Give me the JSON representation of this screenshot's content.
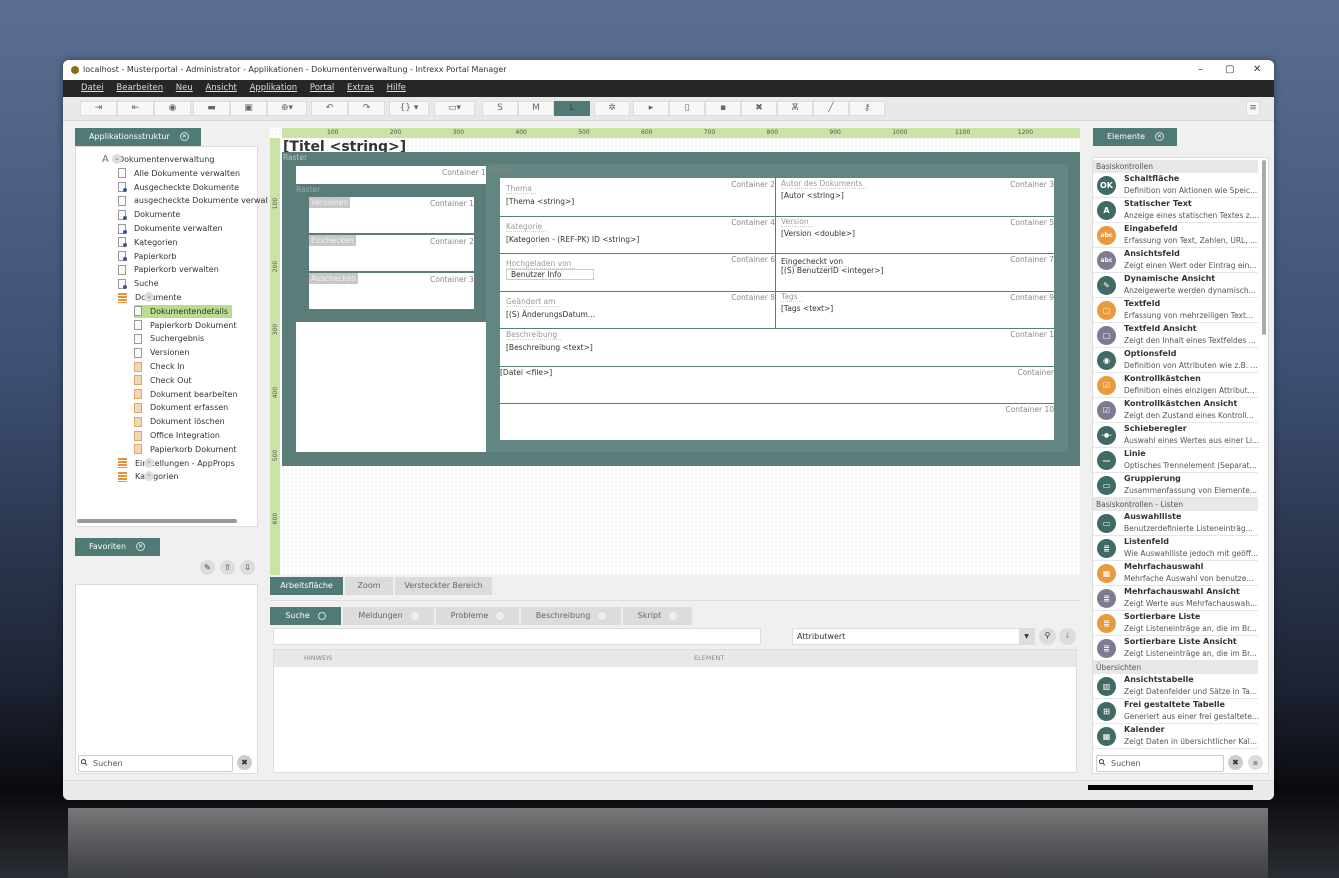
{
  "window": {
    "title": "localhost - Musterportal - Administrator - Applikationen - Dokumentenverwaltung - Intrexx Portal Manager",
    "minimize": "–",
    "maximize": "▢",
    "close": "✕"
  },
  "menu": [
    "Datei",
    "Bearbeiten",
    "Neu",
    "Ansicht",
    "Applikation",
    "Portal",
    "Extras",
    "Hilfe"
  ],
  "toolbar": {
    "size_s": "S",
    "size_m": "M",
    "size_l": "L",
    "braces": "{} ▾",
    "more": "≡"
  },
  "left": {
    "tab": "Applikationsstruktur",
    "tree": [
      {
        "label": "Dokumentenverwaltung",
        "level": 0,
        "icon": "app",
        "exp": "v"
      },
      {
        "label": "Alle Dokumente verwalten",
        "level": 1,
        "icon": "page"
      },
      {
        "label": "Ausgecheckte Dokumente",
        "level": 1,
        "icon": "link"
      },
      {
        "label": "ausgecheckte Dokumente verwal",
        "level": 1,
        "icon": "page"
      },
      {
        "label": "Dokumente",
        "level": 1,
        "icon": "link"
      },
      {
        "label": "Dokumente verwalten",
        "level": 1,
        "icon": "link"
      },
      {
        "label": "Kategorien",
        "level": 1,
        "icon": "link"
      },
      {
        "label": "Papierkorb",
        "level": 1,
        "icon": "link"
      },
      {
        "label": "Papierkorb verwalten",
        "level": 1,
        "icon": "page"
      },
      {
        "label": "Suche",
        "level": 1,
        "icon": "link"
      },
      {
        "label": "Dokumente",
        "level": 1,
        "icon": "db",
        "exp": "v"
      },
      {
        "label": "Dokumentendetails",
        "level": 2,
        "icon": "page",
        "selected": true
      },
      {
        "label": "Papierkorb Dokument",
        "level": 2,
        "icon": "page"
      },
      {
        "label": "Suchergebnis",
        "level": 2,
        "icon": "page"
      },
      {
        "label": "Versionen",
        "level": 2,
        "icon": "page"
      },
      {
        "label": "Check In",
        "level": 2,
        "icon": "orange"
      },
      {
        "label": "Check Out",
        "level": 2,
        "icon": "orange"
      },
      {
        "label": "Dokument bearbeiten",
        "level": 2,
        "icon": "orange"
      },
      {
        "label": "Dokument erfassen",
        "level": 2,
        "icon": "orange"
      },
      {
        "label": "Dokument löschen",
        "level": 2,
        "icon": "orange"
      },
      {
        "label": "Office Integration",
        "level": 2,
        "icon": "orange"
      },
      {
        "label": "Papierkorb Dokument",
        "level": 2,
        "icon": "orange"
      },
      {
        "label": "Einstellungen - AppProps",
        "level": 1,
        "icon": "db",
        "exp": ">"
      },
      {
        "label": "Kategorien",
        "level": 1,
        "icon": "db",
        "exp": ">"
      }
    ],
    "favorites_tab": "Favoriten",
    "search_placeholder": "Suchen"
  },
  "canvas": {
    "ruler_h": [
      "100",
      "200",
      "300",
      "400",
      "500",
      "600",
      "700",
      "800",
      "900",
      "1000",
      "1100",
      "1200"
    ],
    "ruler_v": [
      "100",
      "200",
      "300",
      "400",
      "500",
      "600"
    ],
    "title_field": "[Titel <string>]",
    "raster": "Raster",
    "left": {
      "container1": "Container 1",
      "raster_right": "Raster",
      "raster": "Raster",
      "buttons": [
        {
          "label": "Versionen",
          "container": "Container 1"
        },
        {
          "label": "Einchecken",
          "container": "Container 2"
        },
        {
          "label": "Auschecken",
          "container": "Container 3"
        }
      ]
    },
    "rows": [
      {
        "l_label": "Thema",
        "l_field": "[Thema <string>]",
        "l_container": "Container 2",
        "r_label": "Autor des Dokuments",
        "r_field": "[Autor <string>]",
        "r_container": "Container 3"
      },
      {
        "l_label": "Kategorie",
        "l_field": "[Kategorien - (REF-PK) ID <string>]",
        "l_container": "Container 4",
        "r_label": "Version",
        "r_field": "[Version <double>]",
        "r_container": "Container 5"
      },
      {
        "l_label": "Hochgeladen von",
        "l_field": "Benutzer Info",
        "l_container": "Container 6",
        "r_label": "Eingecheckt von",
        "r_field": "[(S) BenutzerID <integer>]",
        "r_container": "Container 7"
      },
      {
        "l_label": "Geändert am",
        "l_field": "[(S) ÄnderungsDatum...",
        "l_container": "Container 8",
        "r_label": "Tags",
        "r_field": "[Tags <text>]",
        "r_container": "Container 9"
      }
    ],
    "full_rows": [
      {
        "label": "Beschreibung",
        "field": "[Beschreibung <text>]",
        "container": "Container 1"
      },
      {
        "label": "",
        "field": "[Datei <file>]",
        "container": "Container"
      },
      {
        "label": "",
        "field": "",
        "container": "Container 10"
      }
    ]
  },
  "view_tabs": [
    "Arbeitsfläche",
    "Zoom",
    "Versteckter Bereich"
  ],
  "bottom_tabs": [
    "Suche",
    "Meldungen",
    "Probleme",
    "Beschreibung",
    "Skript"
  ],
  "bottom": {
    "search_value": "",
    "select_value": "Attributwert",
    "columns": [
      "HINWEIS",
      "ELEMENT"
    ]
  },
  "right": {
    "tab": "Elemente",
    "search_placeholder": "Suchen",
    "sections": [
      {
        "title": "Basiskontrollen",
        "items": [
          {
            "name": "Schaltfläche",
            "desc": "Definition von Aktionen wie Speic...",
            "color": "#3f6a66",
            "glyph": "OK"
          },
          {
            "name": "Statischer Text",
            "desc": "Anzeige eines statischen Textes z....",
            "color": "#3f6a66",
            "glyph": "A"
          },
          {
            "name": "Eingabefeld",
            "desc": "Erfassung von Text, Zahlen, URL, ...",
            "color": "#e89a3e",
            "glyph": "abc"
          },
          {
            "name": "Ansichtsfeld",
            "desc": "Zeigt einen Wert oder Eintrag ein...",
            "color": "#7d7a92",
            "glyph": "abc"
          },
          {
            "name": "Dynamische Ansicht",
            "desc": "Anzeigewerte werden dynamisch...",
            "color": "#3f6a66",
            "glyph": "✎"
          },
          {
            "name": "Textfeld",
            "desc": "Erfassung von mehrzeiligen Text...",
            "color": "#e89a3e",
            "glyph": "▢"
          },
          {
            "name": "Textfeld Ansicht",
            "desc": "Zeigt den Inhalt eines Textfeldes ...",
            "color": "#7d7a92",
            "glyph": "▢"
          },
          {
            "name": "Optionsfeld",
            "desc": "Definition von Attributen wie z.B. ...",
            "color": "#3f6a66",
            "glyph": "◉"
          },
          {
            "name": "Kontrollkästchen",
            "desc": "Definition eines einzigen Attribut...",
            "color": "#e89a3e",
            "glyph": "☑"
          },
          {
            "name": "Kontrollkästchen Ansicht",
            "desc": "Zeigt den Zustand eines Kontroll...",
            "color": "#7d7a92",
            "glyph": "☑"
          },
          {
            "name": "Schieberegler",
            "desc": "Auswahl eines Wertes aus einer Li...",
            "color": "#3f6a66",
            "glyph": "-●-"
          },
          {
            "name": "Linie",
            "desc": "Optisches Trennelement (Separat...",
            "color": "#3f6a66",
            "glyph": "—"
          },
          {
            "name": "Gruppierung",
            "desc": "Zusammenfassung von Elemente...",
            "color": "#3f6a66",
            "glyph": "▭"
          }
        ]
      },
      {
        "title": "Basiskontrollen - Listen",
        "items": [
          {
            "name": "Auswahlliste",
            "desc": "Benutzerdefinierte Listeneinträg...",
            "color": "#3f6a66",
            "glyph": "▭"
          },
          {
            "name": "Listenfeld",
            "desc": "Wie Auswahlliste jedoch mit geöff...",
            "color": "#3f6a66",
            "glyph": "≣"
          },
          {
            "name": "Mehrfachauswahl",
            "desc": "Mehrfache Auswahl von benutze...",
            "color": "#e89a3e",
            "glyph": "▦"
          },
          {
            "name": "Mehrfachauswahl Ansicht",
            "desc": "Zeigt Werte aus Mehrfachauswah...",
            "color": "#7d7a92",
            "glyph": "≣"
          },
          {
            "name": "Sortierbare Liste",
            "desc": "Zeigt Listeneinträge an, die im Br...",
            "color": "#e89a3e",
            "glyph": "≣"
          },
          {
            "name": "Sortierbare Liste Ansicht",
            "desc": "Zeigt Listeneinträge an, die im Br...",
            "color": "#7d7a92",
            "glyph": "≣"
          }
        ]
      },
      {
        "title": "Übersichten",
        "items": [
          {
            "name": "Ansichtstabelle",
            "desc": "Zeigt Datenfelder und Sätze in Ta...",
            "color": "#3f6a66",
            "glyph": "▥"
          },
          {
            "name": "Frei gestaltete Tabelle",
            "desc": "Generiert aus einer frei gestaltete...",
            "color": "#3f6a66",
            "glyph": "⊞"
          },
          {
            "name": "Kalender",
            "desc": "Zeigt Daten in übersichtlicher Kal...",
            "color": "#3f6a66",
            "glyph": "▦"
          }
        ]
      }
    ]
  }
}
